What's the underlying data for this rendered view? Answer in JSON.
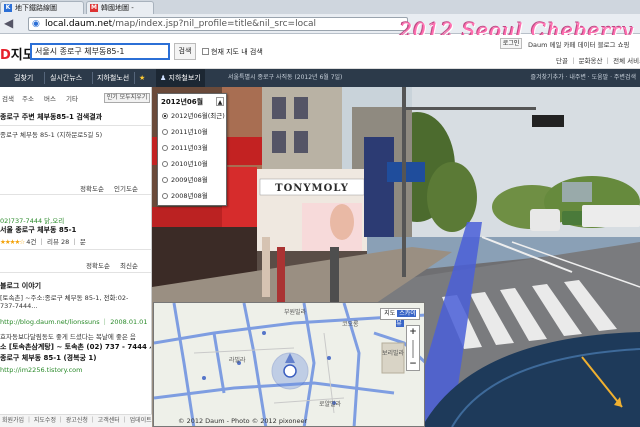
{
  "browser": {
    "tabs": [
      {
        "label": "地下鐵路線圖"
      },
      {
        "label": "韓國地圖 -"
      }
    ],
    "url_host": "local.daum.net",
    "url_path": "/map/index.jsp?nil_profile=title&nil_src=local",
    "watermark": "2012 Seoul Cheberry"
  },
  "header": {
    "logo_d": "D",
    "logo_text": "지도",
    "search_value": "서울시 종로구 체부동85-1",
    "search_button": "검색",
    "search_in_map": "현재 지도 내 검색",
    "login": "로그인",
    "top_links": "Daum  메일  카페  데이터  블로그  쇼핑",
    "sub_links": "단골 ｜ 문화옹산 ｜ 전체 서비스"
  },
  "toolbar": {
    "items": [
      "길찾기",
      "실시간뉴스",
      "지하철노선",
      "★",
      "지하철보기"
    ],
    "roadview": "지하철보기",
    "address": "서울특별시 종로구 사직동 (2012년 6월 7일)",
    "right": "즐겨찾기추가  ·  내주변  ·  도움말  ·  주변검색"
  },
  "left_panel": {
    "categories": [
      "검색",
      "주소",
      "버스",
      "기타"
    ],
    "popular_button": "인기 모두지우기",
    "result_title": "종로구 주변 체부동85-1 검색결과",
    "address_line": "종로구 체부동 85-1 (지하문로5길 5)",
    "sort": [
      "정확도순",
      "인기도순"
    ],
    "place_phone": "02)737-7444  닭,오리",
    "place_addr": "서울 종로구 체부동 85-1",
    "place_rating": "★★★★☆",
    "place_reviews": "4건 ｜ 리뷰 28 ｜ 문",
    "sort2": [
      "정확도순",
      "최신순"
    ],
    "blog_title": "블로그 이야기",
    "blog_line1": "[토속촌] ~주소:종로구 체부동 85-1, 전화:02-",
    "blog_line2": "737-7444...",
    "blog_url": "http://blog.daum.net/lionssuns ｜ 2008.01.01",
    "blog2_line1": "효자동보다달림동도 좋게 드셨다는 복날에 좋은 음",
    "blog2_line2": "소 [토속촌삼계탕] ~ 토속촌 (02) 737 - 7444 서울시",
    "blog2_line3": "종로구 체부동 85-1 (경복궁 1)",
    "blog2_url": "http://im2256.tistory.com",
    "footer": "회원가입 ｜ 지도수정 ｜ 광고신청 ｜ 고객센터 ｜ 업데이트"
  },
  "date_panel": {
    "selected": "2012년06월",
    "options": [
      {
        "label": "2012년06월(최근)",
        "selected": true
      },
      {
        "label": "2011년10월",
        "selected": false
      },
      {
        "label": "2011년03월",
        "selected": false
      },
      {
        "label": "2010년10월",
        "selected": false
      },
      {
        "label": "2009년08월",
        "selected": false
      },
      {
        "label": "2008년08월",
        "selected": false
      }
    ]
  },
  "roadview": {
    "shop_sign": "TONYMOLY",
    "shop_sign2": "TONY MOLY"
  },
  "minimap": {
    "labels": [
      "부원빌라",
      "코오롱",
      "보리빌라",
      "라빌라",
      "로얄빌라"
    ],
    "mode_off": "지도",
    "mode_on": "스카이뷰",
    "zoom_in": "+",
    "zoom_out": "−",
    "footer": "© 2012 Daum - Photo © 2012 pixoneer"
  },
  "colors": {
    "accent": "#2b6fd6",
    "toolbar": "#2c3a4a",
    "watermark": "#ff6fb0",
    "route": "#4a5fd8"
  }
}
